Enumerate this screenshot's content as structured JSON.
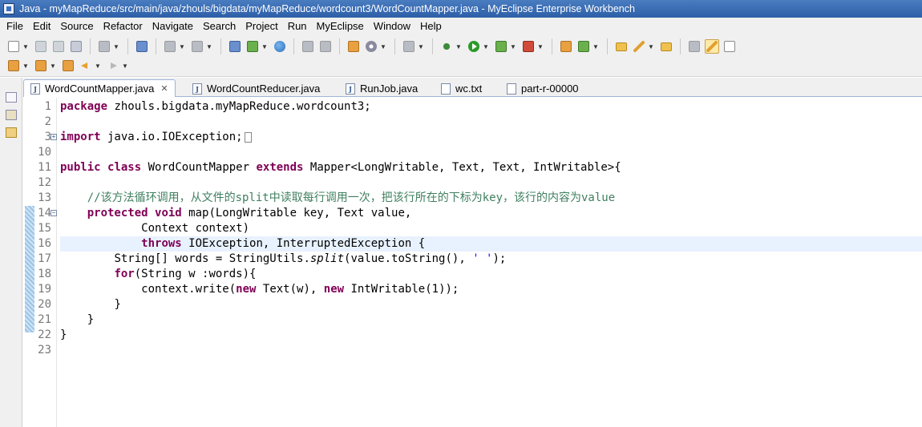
{
  "window": {
    "title": "Java - myMapReduce/src/main/java/zhouls/bigdata/myMapReduce/wordcount3/WordCountMapper.java - MyEclipse Enterprise Workbench"
  },
  "menu": [
    "File",
    "Edit",
    "Source",
    "Refactor",
    "Navigate",
    "Search",
    "Project",
    "Run",
    "MyEclipse",
    "Window",
    "Help"
  ],
  "tabs": [
    {
      "label": "WordCountMapper.java",
      "active": true,
      "icon": "java-file-icon"
    },
    {
      "label": "WordCountReducer.java",
      "active": false,
      "icon": "java-file-icon"
    },
    {
      "label": "RunJob.java",
      "active": false,
      "icon": "java-file-icon"
    },
    {
      "label": "wc.txt",
      "active": false,
      "icon": "text-file-icon"
    },
    {
      "label": "part-r-00000",
      "active": false,
      "icon": "text-file-icon"
    }
  ],
  "editor": {
    "highlighted_line": 16,
    "line_numbers": [
      "1",
      "2",
      "3",
      "10",
      "11",
      "12",
      "13",
      "14",
      "15",
      "16",
      "17",
      "18",
      "19",
      "20",
      "21",
      "22",
      "23"
    ],
    "code": {
      "l1_kw": "package",
      "l1_rest": " zhouls.bigdata.myMapReduce.wordcount3;",
      "l3_kw": "import",
      "l3_rest": " java.io.IOException;",
      "l11_kw1": "public",
      "l11_kw2": "class",
      "l11_mid": " WordCountMapper ",
      "l11_kw3": "extends",
      "l11_rest": " Mapper<LongWritable, Text, Text, IntWritable>{",
      "l13_comment": "//该方法循环调用，从文件的split中读取每行调用一次，把该行所在的下标为key，该行的内容为value",
      "l14_kw1": "protected",
      "l14_kw2": "void",
      "l14_rest": " map(LongWritable key, Text value,",
      "l15": "Context context)",
      "l16_kw": "throws",
      "l16_rest": " IOException, InterruptedException {",
      "l17_a": "String[] words = StringUtils.",
      "l17_it": "split",
      "l17_b": "(value.toString(), ",
      "l17_str": "' '",
      "l17_c": ");",
      "l18_kw": "for",
      "l18_rest": "(String w :words){",
      "l19_a": "context.write(",
      "l19_kw1": "new",
      "l19_b": " Text(w), ",
      "l19_kw2": "new",
      "l19_c": " IntWritable(1));",
      "l20": "}",
      "l21": "}",
      "l22": "}"
    }
  }
}
